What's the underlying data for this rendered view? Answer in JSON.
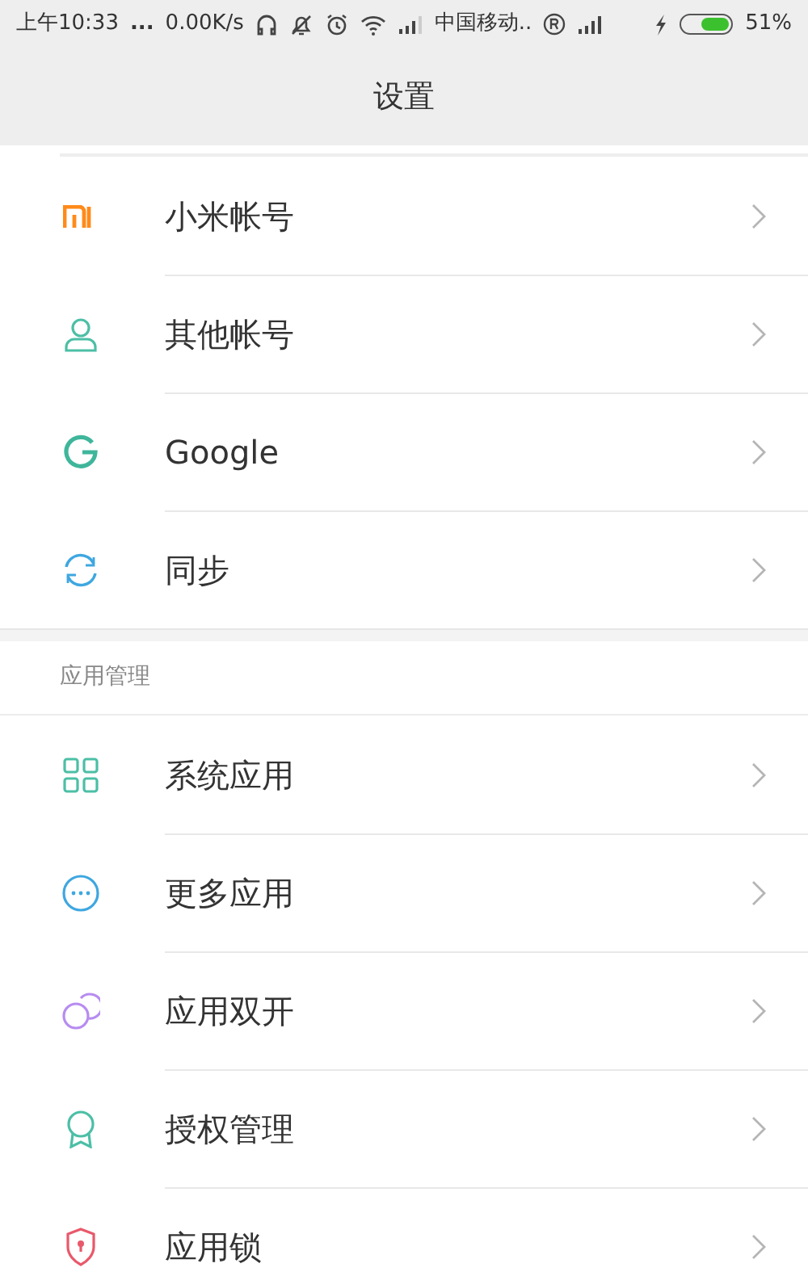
{
  "status_bar": {
    "time": "上午10:33",
    "more": "...",
    "speed": "0.00K/s",
    "carrier": "中国移动..",
    "battery": "51%"
  },
  "header": {
    "title": "设置"
  },
  "sections": [
    {
      "items": [
        {
          "label": "小米帐号"
        },
        {
          "label": "其他帐号"
        },
        {
          "label": "Google"
        },
        {
          "label": "同步"
        }
      ]
    },
    {
      "title": "应用管理",
      "items": [
        {
          "label": "系统应用"
        },
        {
          "label": "更多应用"
        },
        {
          "label": "应用双开"
        },
        {
          "label": "授权管理"
        },
        {
          "label": "应用锁"
        }
      ]
    }
  ]
}
